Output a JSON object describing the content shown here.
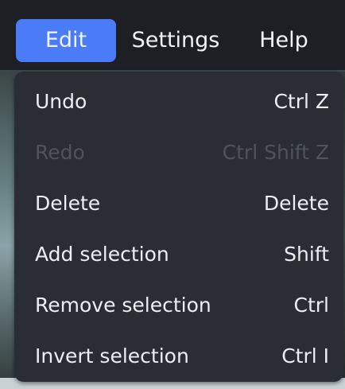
{
  "menubar": {
    "items": [
      {
        "label": "Edit",
        "active": true
      },
      {
        "label": "Settings",
        "active": false
      },
      {
        "label": "Help",
        "active": false
      }
    ]
  },
  "edit_menu": {
    "items": [
      {
        "label": "Undo",
        "shortcut": "Ctrl Z",
        "enabled": true
      },
      {
        "label": "Redo",
        "shortcut": "Ctrl Shift Z",
        "enabled": false
      },
      {
        "label": "Delete",
        "shortcut": "Delete",
        "enabled": true
      },
      {
        "label": "Add selection",
        "shortcut": "Shift",
        "enabled": true
      },
      {
        "label": "Remove selection",
        "shortcut": "Ctrl",
        "enabled": true
      },
      {
        "label": "Invert selection",
        "shortcut": "Ctrl I",
        "enabled": true
      }
    ]
  },
  "colors": {
    "accent": "#4a7cf7",
    "menubar_bg": "#1d1f24",
    "dropdown_bg": "#2a2d33",
    "text": "#eceef1",
    "disabled_text": "#4f535a"
  }
}
